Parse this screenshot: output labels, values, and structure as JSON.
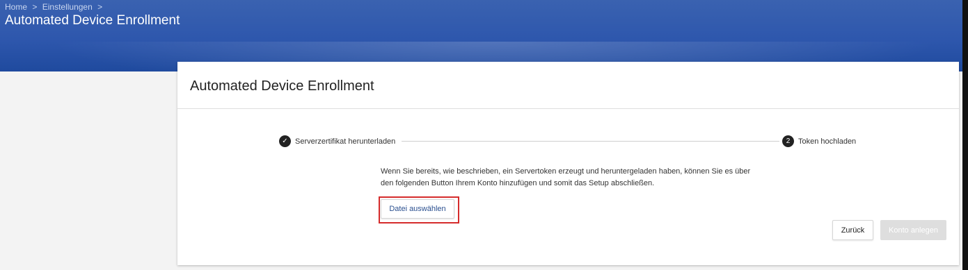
{
  "header": {
    "breadcrumb": [
      "Home",
      ">",
      "Einstellungen",
      ">"
    ],
    "title": "Automated Device Enrollment"
  },
  "card": {
    "title": "Automated Device Enrollment",
    "steps": [
      {
        "marker": "✓",
        "label": "Serverzertifikat herunterladen",
        "state": "completed"
      },
      {
        "marker": "2",
        "label": "Token hochladen",
        "state": "active"
      }
    ],
    "description": "Wenn Sie bereits, wie beschrieben, ein Servertoken erzeugt und heruntergeladen haben, können Sie es über den folgenden Button Ihrem Konto hinzufügen und somit das Setup abschließen.",
    "file_button": "Datei auswählen",
    "back_button": "Zurück",
    "create_button": "Konto anlegen"
  },
  "colors": {
    "header_bg": "#2e57ad",
    "highlight": "#d52b2b",
    "link_text": "#2a4f8f",
    "disabled_bg": "#dedede"
  }
}
